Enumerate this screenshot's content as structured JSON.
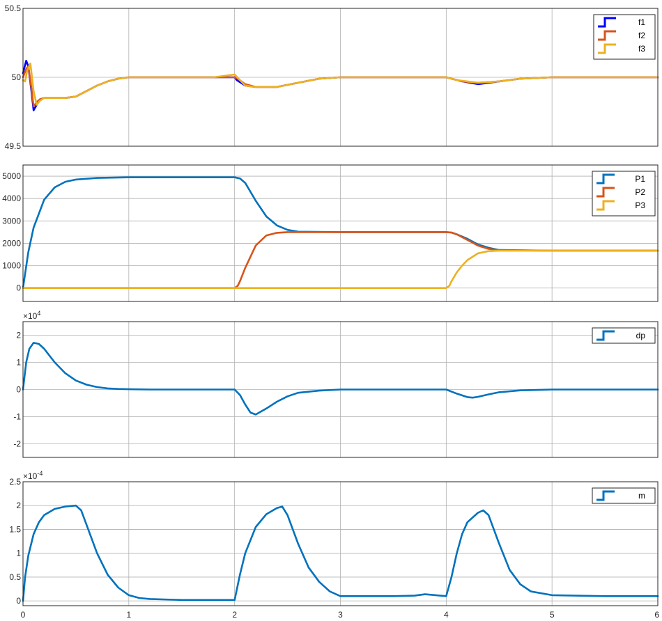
{
  "chart_data": [
    {
      "type": "line",
      "xlim": [
        0,
        6
      ],
      "ylim": [
        49.5,
        50.5
      ],
      "yticks": [
        "49.5",
        "50",
        "50.5"
      ],
      "exponent": "",
      "grid": true,
      "legend_position": "top-right",
      "series": [
        {
          "name": "f1",
          "color": "#0000FF",
          "x": [
            0,
            0.03,
            0.05,
            0.08,
            0.1,
            0.13,
            0.16,
            0.2,
            0.3,
            0.4,
            0.5,
            0.6,
            0.7,
            0.8,
            0.9,
            1.0,
            1.2,
            1.5,
            1.8,
            2.0,
            2.02,
            2.1,
            2.2,
            2.4,
            2.6,
            2.8,
            3.0,
            3.5,
            4.0,
            4.05,
            4.15,
            4.3,
            4.5,
            4.7,
            5.0,
            6.0
          ],
          "y": [
            50.03,
            50.12,
            50.08,
            49.9,
            49.76,
            49.8,
            49.84,
            49.85,
            49.85,
            49.85,
            49.86,
            49.9,
            49.94,
            49.97,
            49.99,
            50.0,
            50.0,
            50.0,
            50.0,
            50.0,
            49.98,
            49.94,
            49.93,
            49.93,
            49.96,
            49.99,
            50.0,
            50.0,
            50.0,
            49.99,
            49.97,
            49.95,
            49.97,
            49.99,
            50.0,
            50.0
          ]
        },
        {
          "name": "f2",
          "color": "#D95319",
          "x": [
            0,
            0.03,
            0.05,
            0.08,
            0.1,
            0.13,
            0.16,
            0.2,
            0.3,
            0.4,
            0.5,
            0.6,
            0.7,
            0.8,
            0.9,
            1.0,
            1.2,
            1.5,
            1.8,
            2.0,
            2.03,
            2.1,
            2.2,
            2.4,
            2.6,
            2.8,
            3.0,
            3.5,
            4.0,
            4.05,
            4.15,
            4.3,
            4.5,
            4.7,
            5.0,
            6.0
          ],
          "y": [
            50.0,
            50.06,
            50.08,
            49.92,
            49.79,
            49.82,
            49.84,
            49.85,
            49.85,
            49.85,
            49.86,
            49.9,
            49.94,
            49.97,
            49.99,
            50.0,
            50.0,
            50.0,
            50.0,
            50.0,
            49.99,
            49.95,
            49.93,
            49.93,
            49.96,
            49.99,
            50.0,
            50.0,
            50.0,
            49.99,
            49.97,
            49.96,
            49.97,
            49.99,
            50.0,
            50.0
          ]
        },
        {
          "name": "f3",
          "color": "#EDB120",
          "x": [
            0,
            0.02,
            0.04,
            0.07,
            0.1,
            0.13,
            0.16,
            0.2,
            0.3,
            0.4,
            0.5,
            0.6,
            0.7,
            0.8,
            0.9,
            1.0,
            1.2,
            1.5,
            1.8,
            2.0,
            2.05,
            2.1,
            2.2,
            2.4,
            2.6,
            2.8,
            3.0,
            3.5,
            4.0,
            4.1,
            4.2,
            4.3,
            4.5,
            4.7,
            5.0,
            6.0
          ],
          "y": [
            49.98,
            49.97,
            50.05,
            50.1,
            49.9,
            49.8,
            49.83,
            49.85,
            49.85,
            49.85,
            49.86,
            49.9,
            49.94,
            49.97,
            49.99,
            50.0,
            50.0,
            50.0,
            50.0,
            50.02,
            49.98,
            49.94,
            49.93,
            49.93,
            49.96,
            49.99,
            50.0,
            50.0,
            50.0,
            49.98,
            49.97,
            49.96,
            49.97,
            49.99,
            50.0,
            50.0
          ]
        }
      ]
    },
    {
      "type": "line",
      "xlim": [
        0,
        6
      ],
      "ylim": [
        -600,
        5500
      ],
      "yticks": [
        "0",
        "1000",
        "2000",
        "3000",
        "4000",
        "5000"
      ],
      "exponent": "",
      "grid": true,
      "legend_position": "top-right",
      "series": [
        {
          "name": "P1",
          "color": "#0072BD",
          "x": [
            0,
            0.05,
            0.1,
            0.2,
            0.3,
            0.4,
            0.5,
            0.7,
            1.0,
            1.5,
            2.0,
            2.05,
            2.1,
            2.2,
            2.3,
            2.4,
            2.5,
            2.6,
            3.0,
            3.5,
            4.0,
            4.05,
            4.1,
            4.2,
            4.3,
            4.4,
            4.5,
            5.0,
            6.0
          ],
          "y": [
            0,
            1600,
            2700,
            3950,
            4500,
            4750,
            4850,
            4920,
            4950,
            4950,
            4950,
            4900,
            4700,
            3900,
            3200,
            2800,
            2600,
            2520,
            2500,
            2500,
            2500,
            2480,
            2400,
            2200,
            1950,
            1800,
            1700,
            1670,
            1670
          ]
        },
        {
          "name": "P2",
          "color": "#D95319",
          "x": [
            0,
            1.0,
            2.0,
            2.03,
            2.05,
            2.1,
            2.2,
            2.3,
            2.4,
            2.5,
            2.6,
            3.0,
            3.5,
            4.0,
            4.05,
            4.1,
            4.2,
            4.3,
            4.4,
            4.5,
            5.0,
            6.0
          ],
          "y": [
            0,
            0,
            0,
            100,
            300,
            900,
            1900,
            2350,
            2470,
            2500,
            2500,
            2500,
            2500,
            2500,
            2480,
            2400,
            2150,
            1900,
            1750,
            1690,
            1670,
            1670
          ]
        },
        {
          "name": "P3",
          "color": "#EDB120",
          "x": [
            0,
            1.0,
            2.0,
            3.0,
            4.0,
            4.03,
            4.05,
            4.1,
            4.15,
            4.2,
            4.3,
            4.4,
            4.5,
            4.6,
            5.0,
            6.0
          ],
          "y": [
            0,
            0,
            0,
            0,
            0,
            100,
            300,
            700,
            1000,
            1250,
            1550,
            1650,
            1670,
            1670,
            1670,
            1670
          ]
        }
      ]
    },
    {
      "type": "line",
      "xlim": [
        0,
        6
      ],
      "ylim": [
        -2.5,
        2.5
      ],
      "yticks": [
        "-2",
        "-1",
        "0",
        "1",
        "2"
      ],
      "exponent": "4",
      "grid": true,
      "legend_position": "top-right",
      "series": [
        {
          "name": "dp",
          "color": "#0072BD",
          "x": [
            0,
            0.03,
            0.06,
            0.1,
            0.15,
            0.2,
            0.3,
            0.4,
            0.5,
            0.6,
            0.7,
            0.8,
            0.9,
            1.0,
            1.2,
            1.5,
            2.0,
            2.05,
            2.1,
            2.15,
            2.2,
            2.3,
            2.4,
            2.5,
            2.6,
            2.8,
            3.0,
            3.5,
            4.0,
            4.1,
            4.2,
            4.25,
            4.3,
            4.4,
            4.5,
            4.7,
            5.0,
            6.0
          ],
          "y": [
            0,
            1.0,
            1.5,
            1.72,
            1.68,
            1.5,
            1.0,
            0.6,
            0.33,
            0.18,
            0.09,
            0.04,
            0.02,
            0.01,
            0.0,
            0.0,
            0.0,
            -0.2,
            -0.55,
            -0.85,
            -0.92,
            -0.7,
            -0.45,
            -0.25,
            -0.12,
            -0.04,
            0.0,
            0.0,
            0.0,
            -0.15,
            -0.28,
            -0.3,
            -0.27,
            -0.18,
            -0.1,
            -0.03,
            0.0,
            0.0
          ]
        }
      ]
    },
    {
      "type": "line",
      "xlim": [
        0,
        6
      ],
      "ylim": [
        -0.1,
        2.5
      ],
      "yticks": [
        "0",
        "0.5",
        "1",
        "1.5",
        "2",
        "2.5"
      ],
      "xticks": [
        "0",
        "1",
        "2",
        "3",
        "4",
        "5",
        "6"
      ],
      "exponent": "-4",
      "grid": true,
      "legend_position": "top-right",
      "series": [
        {
          "name": "m",
          "color": "#0072BD",
          "x": [
            0,
            0.02,
            0.05,
            0.1,
            0.15,
            0.2,
            0.3,
            0.4,
            0.5,
            0.55,
            0.6,
            0.7,
            0.8,
            0.9,
            1.0,
            1.1,
            1.2,
            1.5,
            2.0,
            2.0,
            2.05,
            2.1,
            2.2,
            2.3,
            2.4,
            2.45,
            2.5,
            2.6,
            2.7,
            2.8,
            2.9,
            3.0,
            3.5,
            3.7,
            3.8,
            4.0,
            4.05,
            4.1,
            4.15,
            4.2,
            4.3,
            4.35,
            4.4,
            4.5,
            4.6,
            4.7,
            4.8,
            5.0,
            5.5,
            6.0
          ],
          "y": [
            0,
            0.5,
            0.95,
            1.4,
            1.65,
            1.8,
            1.93,
            1.98,
            2.0,
            1.9,
            1.6,
            1.0,
            0.55,
            0.28,
            0.12,
            0.06,
            0.04,
            0.02,
            0.02,
            0.02,
            0.55,
            1.0,
            1.55,
            1.82,
            1.95,
            1.98,
            1.8,
            1.2,
            0.7,
            0.4,
            0.2,
            0.1,
            0.1,
            0.11,
            0.14,
            0.1,
            0.5,
            1.0,
            1.4,
            1.65,
            1.85,
            1.9,
            1.8,
            1.2,
            0.65,
            0.35,
            0.2,
            0.12,
            0.1,
            0.1
          ]
        }
      ]
    }
  ]
}
